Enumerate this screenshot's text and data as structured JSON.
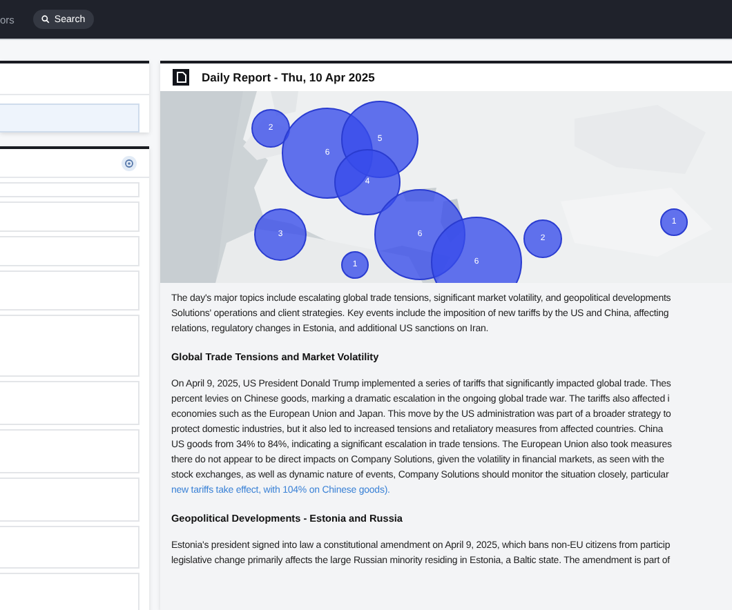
{
  "nav": {
    "link": "ors",
    "search": "Search"
  },
  "report": {
    "title": "Daily Report - Thu, 10 Apr 2025",
    "markers": [
      {
        "count": "2"
      },
      {
        "count": "6"
      },
      {
        "count": "5"
      },
      {
        "count": "4"
      },
      {
        "count": "6"
      },
      {
        "count": "6"
      },
      {
        "count": "3"
      },
      {
        "count": "1"
      },
      {
        "count": "2"
      },
      {
        "count": "1"
      }
    ],
    "body": [
      {
        "kind": "paragraph",
        "lines": [
          "The day's major topics include escalating global trade tensions, significant market volatility, and geopolitical developments",
          "Solutions' operations and client strategies. Key events include the imposition of new tariffs by the US and China, affecting",
          "relations, regulatory changes in Estonia, and additional US sanctions on Iran."
        ]
      },
      {
        "kind": "heading",
        "text": "Global Trade Tensions and Market Volatility"
      },
      {
        "kind": "paragraph",
        "lines": [
          "On April 9, 2025, US President Donald Trump implemented a series of tariffs that significantly impacted global trade. Thes",
          "percent levies on Chinese goods, marking a dramatic escalation in the ongoing global trade war. The tariffs also affected i",
          "economies such as the European Union and Japan. This move by the US administration was part of a broader strategy to",
          "protect domestic industries, but it also led to increased tensions and retaliatory measures from affected countries. China",
          "US goods from 34% to 84%, indicating a significant escalation in trade tensions. The European Union also took measures",
          "there do not appear to be direct impacts on Company Solutions, given the volatility in financial markets, as seen with the",
          "stock exchanges, as well as dynamic nature of events, Company Solutions should monitor the situation closely, particular"
        ],
        "link": "new tariffs take effect, with 104% on Chinese goods)."
      },
      {
        "kind": "heading",
        "text": "Geopolitical Developments - Estonia and Russia"
      },
      {
        "kind": "paragraph",
        "lines": [
          "Estonia's president signed into law a constitutional amendment on April 9, 2025, which bans non-EU citizens from particip",
          "legislative change primarily affects the large Russian minority residing in Estonia, a Baltic state. The amendment is part of"
        ]
      }
    ]
  }
}
